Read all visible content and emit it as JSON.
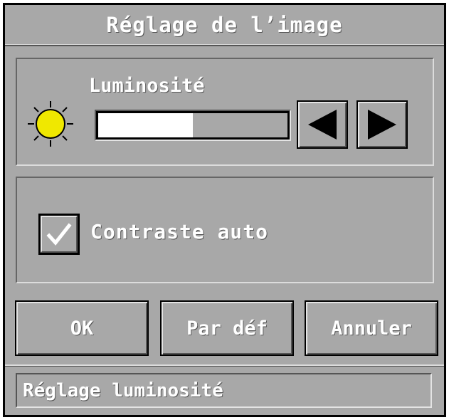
{
  "dialog": {
    "title": "Réglage de l’image"
  },
  "brightness": {
    "label": "Luminosité",
    "level_fraction": 0.5,
    "icon": "sun-icon",
    "decrease_icon": "triangle-left-icon",
    "increase_icon": "triangle-right-icon"
  },
  "contrast": {
    "label": "Contraste auto",
    "checked": true,
    "icon": "checkmark-icon"
  },
  "buttons": {
    "ok": "OK",
    "default": "Par déf",
    "cancel": "Annuler"
  },
  "status": {
    "text": "Réglage luminosité"
  },
  "colors": {
    "panel": "#a8a8a8",
    "sun_fill": "#f0e800",
    "slider_fill": "#ffffff",
    "text": "#ffffff"
  }
}
